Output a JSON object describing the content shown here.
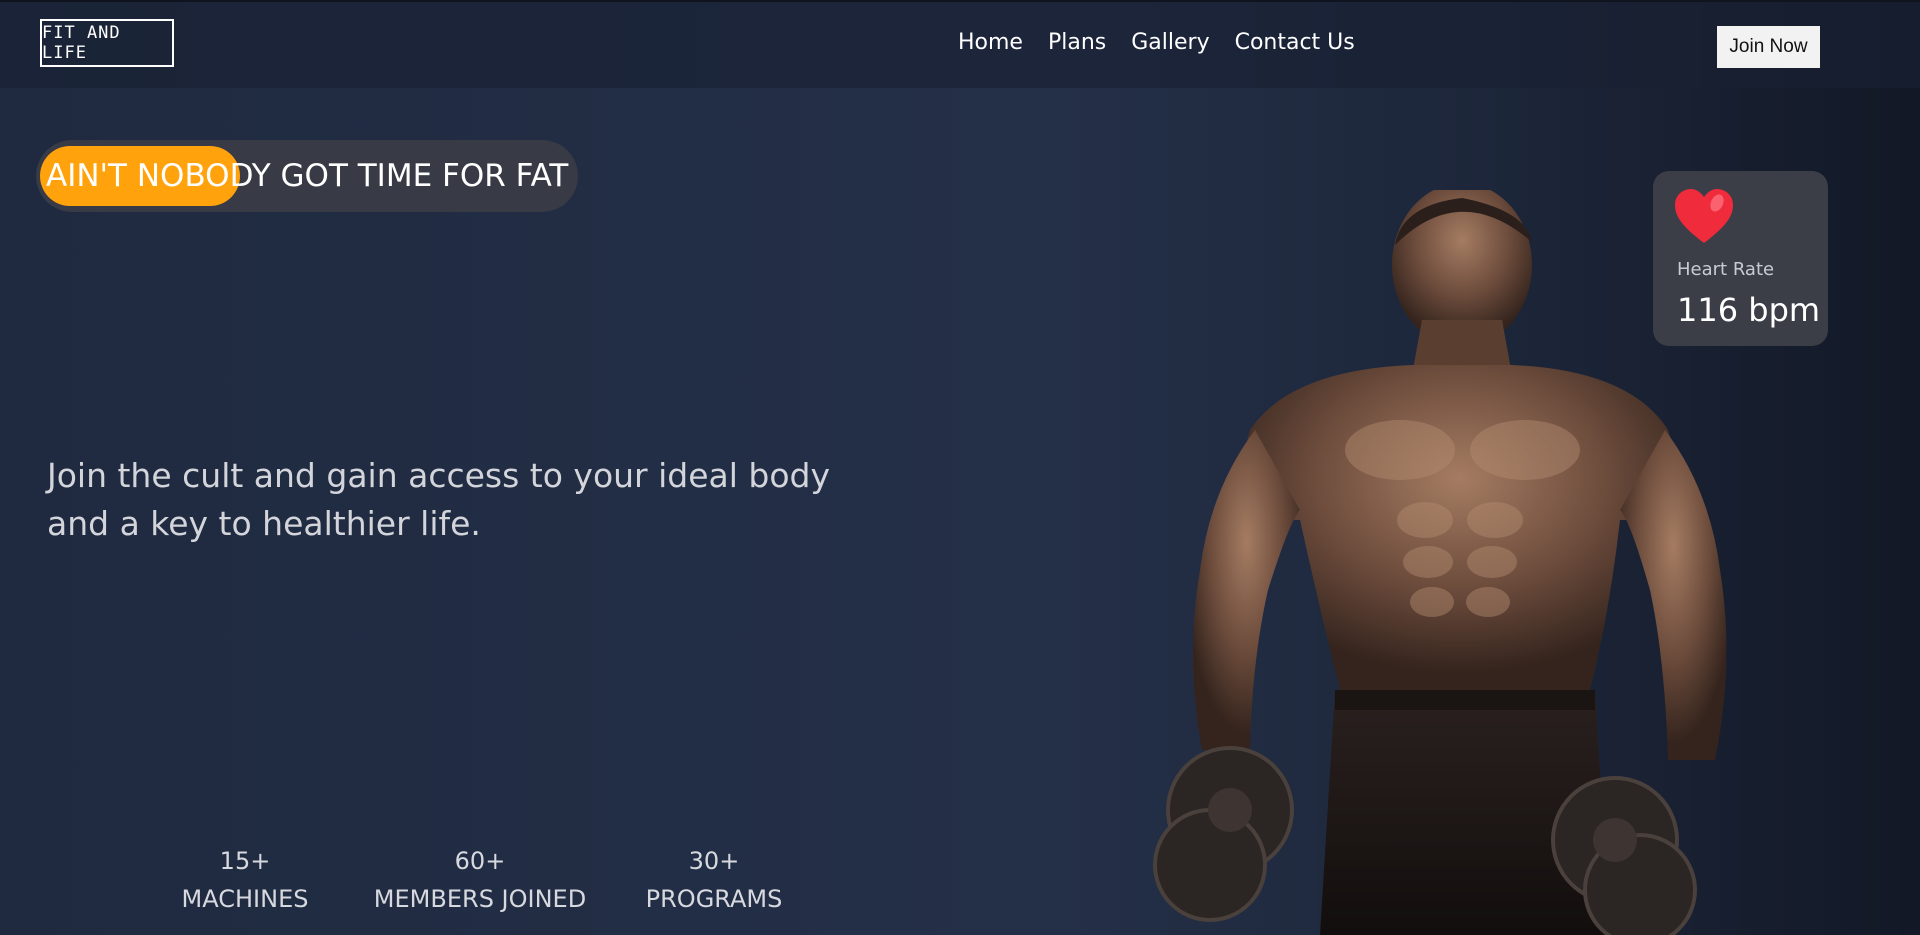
{
  "brand": {
    "logo_text": "FIT AND LIFE"
  },
  "nav": {
    "links": [
      "Home",
      "Plans",
      "Gallery",
      "Contact Us"
    ],
    "join_label": "Join Now"
  },
  "hero": {
    "tagline": "Ain't nobody got time for fat !",
    "text": "Join the cult and gain access to your ideal body and a key to healthier life."
  },
  "stats": [
    {
      "number": "15+",
      "label": "MACHINES"
    },
    {
      "number": "60+",
      "label": "MEMBERS JOINED"
    },
    {
      "number": "30+",
      "label": "PROGRAMS"
    }
  ],
  "heart_rate": {
    "label": "Heart Rate",
    "value": "116 bpm",
    "icon": "heart-icon"
  },
  "colors": {
    "accent": "#ffa20c",
    "background": "#243048",
    "card": "#3c3e47",
    "heart": "#ef2b3c"
  }
}
